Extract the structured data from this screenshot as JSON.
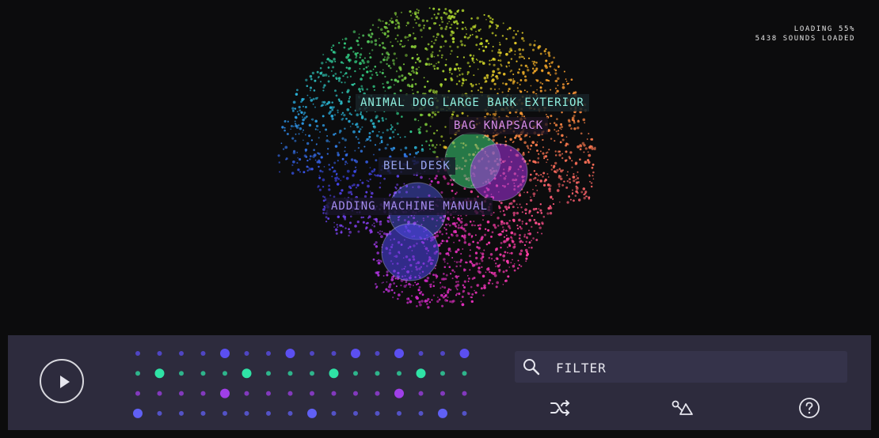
{
  "status": {
    "loading": "LOADING 55%",
    "sounds_loaded": "5438 SOUNDS LOADED"
  },
  "sound_labels": [
    {
      "text": "ANIMAL DOG LARGE BARK EXTERIOR",
      "color": "#8ff0e0"
    },
    {
      "text": "BAG KNAPSACK",
      "color": "#d78be8"
    },
    {
      "text": "BELL DESK",
      "color": "#9aa6f2"
    },
    {
      "text": "ADDING MACHINE MANUAL",
      "color": "#a58cf0"
    }
  ],
  "sequencer": {
    "rows": 4,
    "steps": 16,
    "colors": [
      "#5b4ff0",
      "#2fe3a6",
      "#9f3fe8",
      "#6060f4"
    ],
    "active": [
      [
        4,
        7,
        10,
        12,
        15
      ],
      [
        1,
        5,
        9,
        13
      ],
      [
        4,
        12
      ],
      [
        0,
        8,
        14
      ]
    ]
  },
  "filter": {
    "placeholder": "FILTER",
    "value": ""
  },
  "toolbar": {
    "play_icon": "play-icon",
    "shuffle_icon": "shuffle-icon",
    "shapes_icon": "shapes-icon",
    "help_icon": "help-icon"
  },
  "colors": {
    "background": "#0c0c0d",
    "panel": "#2d2b3d",
    "filter_bg": "#35334a"
  }
}
